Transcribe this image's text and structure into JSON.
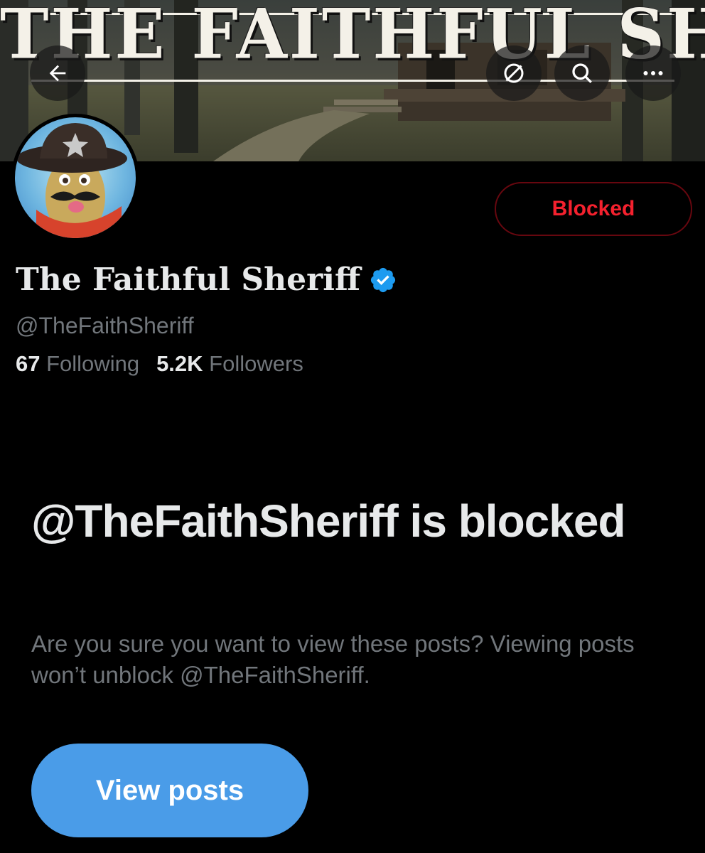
{
  "banner": {
    "title": "THE FAITHFUL SHERIFF"
  },
  "nav": {
    "back_icon": "arrow-left-icon",
    "filter_icon": "slashed-circle-icon",
    "search_icon": "search-icon",
    "more_icon": "more-horizontal-icon"
  },
  "profile": {
    "display_name": "The Faithful Sheriff",
    "verified": true,
    "handle": "@TheFaithSheriff",
    "following_count": "67",
    "following_label": "Following",
    "followers_count": "5.2K",
    "followers_label": "Followers",
    "blocked_button_label": "Blocked"
  },
  "blocked_notice": {
    "heading": "@TheFaithSheriff is blocked",
    "description": "Are you sure you want to view these posts? Viewing posts won’t unblock @TheFaithSheriff.",
    "view_posts_label": "View posts"
  },
  "colors": {
    "background": "#000000",
    "primary_text": "#e7e9ea",
    "secondary_text": "#71767b",
    "blocked_red": "#f4212e",
    "blocked_border": "#67070f",
    "accent_blue": "#4a9ce8",
    "verified_blue": "#1d9bf0"
  }
}
